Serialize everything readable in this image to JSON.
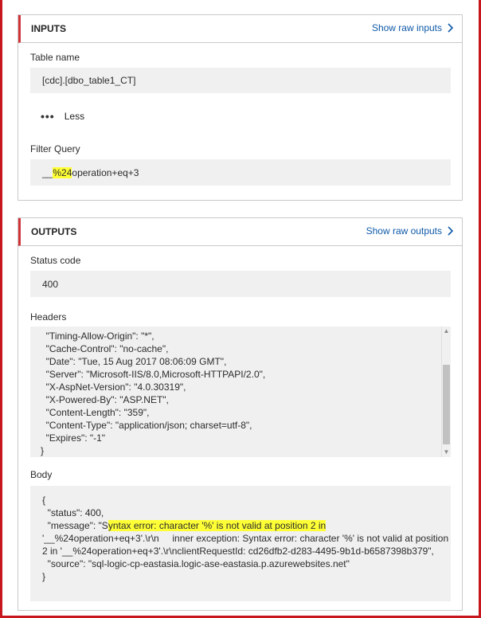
{
  "inputs": {
    "title": "INPUTS",
    "raw_link": "Show raw inputs",
    "table_name_label": "Table name",
    "table_name_value": "[cdc].[dbo_table1_CT]",
    "less_label": "Less",
    "filter_query_label": "Filter Query",
    "filter_prefix": "__",
    "filter_highlight": "%24",
    "filter_suffix": "operation+eq+3"
  },
  "outputs": {
    "title": "OUTPUTS",
    "raw_link": "Show raw outputs",
    "status_code_label": "Status code",
    "status_code_value": "400",
    "headers_label": "Headers",
    "headers_lines": [
      "  \"Timing-Allow-Origin\": \"*\",",
      "  \"Cache-Control\": \"no-cache\",",
      "  \"Date\": \"Tue, 15 Aug 2017 08:06:09 GMT\",",
      "  \"Server\": \"Microsoft-IIS/8.0,Microsoft-HTTPAPI/2.0\",",
      "  \"X-AspNet-Version\": \"4.0.30319\",",
      "  \"X-Powered-By\": \"ASP.NET\",",
      "  \"Content-Length\": \"359\",",
      "  \"Content-Type\": \"application/json; charset=utf-8\",",
      "  \"Expires\": \"-1\"",
      "}"
    ],
    "body_label": "Body",
    "body_open": "{",
    "body_status": "  \"status\": 400,",
    "body_message_prefix": "  \"message\": \"S",
    "body_message_highlight": "yntax error: character '%' is not valid at position 2 in",
    "body_message_rest": "'__%24operation+eq+3'.\\r\\n     inner exception: Syntax error: character '%' is not valid at position 2 in '__%24operation+eq+3'.\\r\\nclientRequestId: cd26dfb2-d283-4495-9b1d-b6587398b379\",",
    "body_source": "  \"source\": \"sql-logic-cp-eastasia.logic-ase-eastasia.p.azurewebsites.net\"",
    "body_close": "}"
  },
  "colors": {
    "frame": "#c8161d",
    "accent_bar": "#d13438",
    "link": "#0f5aa8",
    "highlight": "#ffff36"
  }
}
